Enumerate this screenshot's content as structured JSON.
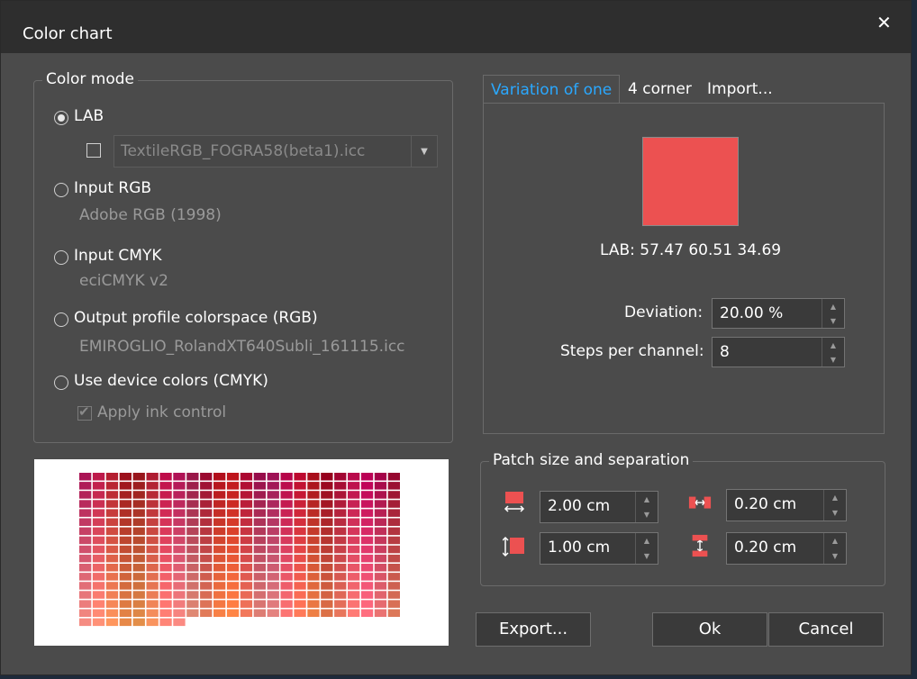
{
  "window": {
    "title": "Color chart",
    "close_glyph": "✕"
  },
  "color_mode": {
    "legend": "Color mode",
    "options": [
      {
        "label": "LAB",
        "checked": true
      },
      {
        "label": "Input RGB",
        "detail": "Adobe RGB (1998)"
      },
      {
        "label": "Input CMYK",
        "detail": "eciCMYK v2"
      },
      {
        "label": "Output profile colorspace (RGB)",
        "detail": "EMIROGLIO_RolandXT640Subli_161115.icc"
      },
      {
        "label": "Use device colors (CMYK)"
      }
    ],
    "lab_profile": {
      "checked": false,
      "value": "TextileRGB_FOGRA58(beta1).icc"
    },
    "apply_ink_control": {
      "label": "Apply ink control",
      "checked": true,
      "disabled": true
    }
  },
  "tabs": [
    {
      "label": "Variation of one",
      "active": true
    },
    {
      "label": "4 corner"
    },
    {
      "label": "Import..."
    }
  ],
  "variation": {
    "swatch_color": "#ec5151",
    "lab_text": "LAB: 57.47 60.51 34.69",
    "deviation_label": "Deviation:",
    "deviation_value": "20.00 %",
    "steps_label": "Steps per channel:",
    "steps_value": "8"
  },
  "patch": {
    "legend": "Patch size and separation",
    "patch_width": "2.00 cm",
    "patch_height": "1.00 cm",
    "sep_horizontal": "0.20 cm",
    "sep_vertical": "0.20 cm"
  },
  "buttons": {
    "export": "Export...",
    "ok": "Ok",
    "cancel": "Cancel"
  },
  "colors": {
    "accent": "#2aa8ff",
    "patch_icon": "#ec5151",
    "dialog_bg": "#4b4b4b",
    "title_bg": "#2e2e2e"
  },
  "preview_grid": {
    "columns": 24,
    "rows": 17,
    "last_row_columns": 8
  }
}
